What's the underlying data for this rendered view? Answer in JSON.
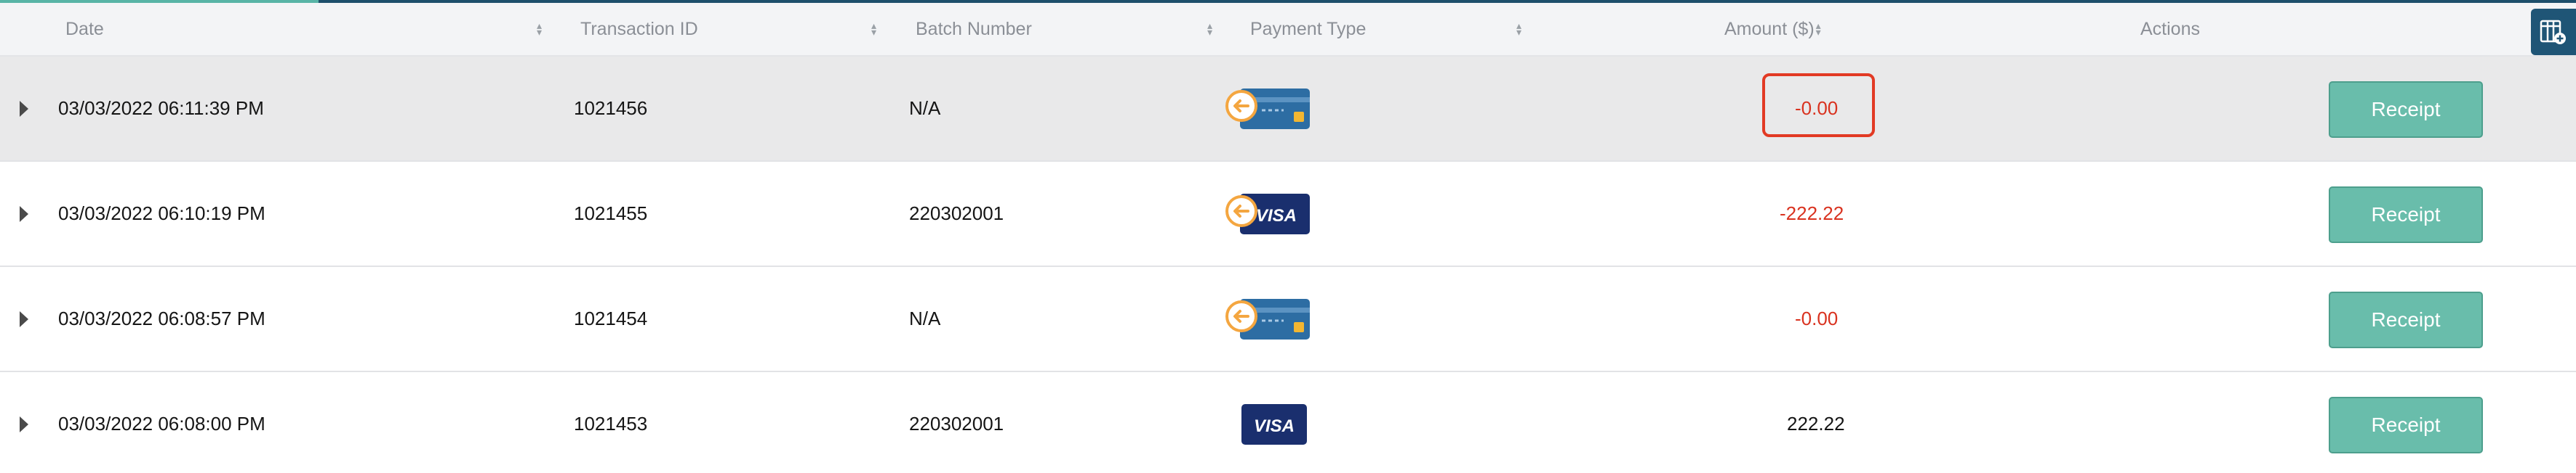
{
  "table": {
    "headers": {
      "date": "Date",
      "transaction_id": "Transaction ID",
      "batch_number": "Batch Number",
      "payment_type": "Payment Type",
      "amount": "Amount ($)",
      "actions": "Actions"
    },
    "rows": [
      {
        "date": "03/03/2022 06:11:39 PM",
        "transaction_id": "1021456",
        "batch_number": "N/A",
        "payment_type_icon": "card-refund-icon",
        "amount": "-0.00",
        "action_label": "Receipt"
      },
      {
        "date": "03/03/2022 06:10:19 PM",
        "transaction_id": "1021455",
        "batch_number": "220302001",
        "payment_type_icon": "visa-refund-icon",
        "visa_text": "VISA",
        "amount": "-222.22",
        "action_label": "Receipt"
      },
      {
        "date": "03/03/2022 06:08:57 PM",
        "transaction_id": "1021454",
        "batch_number": "N/A",
        "payment_type_icon": "card-refund-icon",
        "amount": "-0.00",
        "action_label": "Receipt"
      },
      {
        "date": "03/03/2022 06:08:00 PM",
        "transaction_id": "1021453",
        "batch_number": "220302001",
        "payment_type_icon": "visa-icon",
        "visa_text": "VISA",
        "amount": "222.22",
        "action_label": "Receipt"
      }
    ]
  },
  "colors": {
    "header_bg": "#f3f4f6",
    "selected_row_bg": "#e9e9ea",
    "negative_amount": "#d9321f",
    "highlight_border": "#e23a24",
    "receipt_button": "#69bdab",
    "card_blue": "#2d6da3",
    "visa_navy": "#1a2f6e",
    "refund_orange": "#f4a640",
    "settings_button": "#1f5576"
  }
}
